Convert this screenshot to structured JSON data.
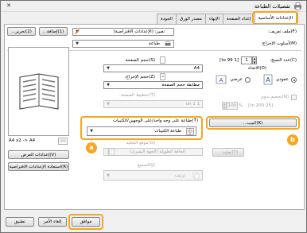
{
  "window": {
    "title": "تفضيلات الطباعة"
  },
  "tabs": [
    {
      "label": "الإعدادات الأساسية",
      "active": true
    },
    {
      "label": "إعداد الصفحة"
    },
    {
      "label": "الإنهاء"
    },
    {
      "label": "مصدر الورق"
    },
    {
      "label": "الجودة"
    }
  ],
  "profile": {
    "label": "(F)ملف تعريف:",
    "value": "تغيير: (الإعدادات الافتراضية)",
    "add_label": "(1)إضافة...",
    "edit_label": "(2)تحرير..."
  },
  "output_method": {
    "label": "(M)أسلوب الإخراج:",
    "value": "طباعة"
  },
  "paper_size": {
    "label": "(S)حجم الصفحة",
    "value": "A4"
  },
  "output_size": {
    "label": "(Z)حجم الإخراج:",
    "value": "مطابقة حجم الصفحة"
  },
  "copies": {
    "label": "(C)عدد النسخ:",
    "value": "1",
    "range": "[1 to 99]"
  },
  "orientation": {
    "label": "(O)الاتجاه",
    "portrait": "عمودي",
    "landscape": "عرضي"
  },
  "page_layout": {
    "label": "(T)تخطيط الصفحة:",
    "value": "1 on 1"
  },
  "manual_scaling": {
    "label": "(N)تحجيم يدوي",
    "value": "100",
    "unit": "%",
    "range": "[25 to 200]"
  },
  "print_style": {
    "label": "(T)طباعة على وجه واحد/على الوجهين/الكتيبات",
    "value": "طباعة الكتيبات",
    "booklet_button": "(K)كتيب..."
  },
  "binding": {
    "label": "(G)موقع التجليد",
    "value": "الحافة الطويلة (الجهة اليسرى)",
    "button": "(T)تجليد..."
  },
  "finishing": {
    "label": "(J)التجميع",
    "value": "ترتيب"
  },
  "preview": {
    "caption": "A4 x2 -> A4"
  },
  "buttons": {
    "view_settings": "(V)إعدادات العرض",
    "restore_defaults": "(R)استعادة الإعدادات الافتراضية",
    "ok": "موافق",
    "cancel": "إلغاء الأمر",
    "apply": "تطبيق"
  },
  "callouts": {
    "a": "a",
    "b": "b"
  },
  "colors": {
    "highlight": "#f5a623",
    "accent": "#1a4fa0"
  }
}
